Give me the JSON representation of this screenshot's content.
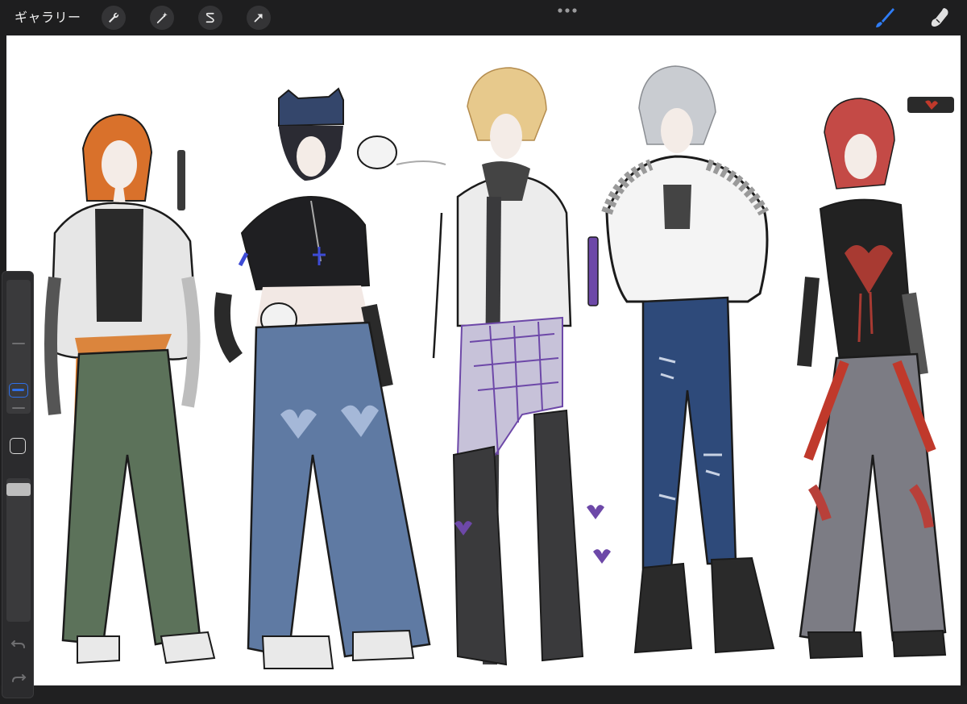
{
  "topbar": {
    "gallery_label": "ギャラリー",
    "tools": [
      "wrench-icon",
      "magic-wand-icon",
      "selection-s-icon",
      "transform-arrow-icon"
    ],
    "more_icon": "ellipsis-icon",
    "right_tools": [
      "brush-icon",
      "smudge-icon"
    ],
    "accent": "#2f7df6"
  },
  "canvas": {
    "background": "#ffffff",
    "figures": [
      {
        "hair": "#d9712b",
        "top": "#e6e6e6",
        "pants": "#5c725a",
        "accent": "#d97a2a"
      },
      {
        "hair": "#2b2b33",
        "top": "#1f1f22",
        "pants": "#5f7aa3",
        "accent": "#3d4bd6"
      },
      {
        "hair": "#e7c98c",
        "top": "#ececec",
        "pants": "#3a3a3c",
        "accent": "#6d48a8"
      },
      {
        "hair": "#c9ccd1",
        "top": "#f4f4f4",
        "pants": "#2e4a7a",
        "accent": "#777777"
      },
      {
        "hair": "#c44a46",
        "top": "#222222",
        "pants": "#7c7c84",
        "accent": "#c0392b"
      }
    ]
  },
  "sidebar": {
    "icons": [
      "size-slider",
      "modifier-square-icon",
      "opacity-slider",
      "undo-icon",
      "redo-icon"
    ]
  }
}
